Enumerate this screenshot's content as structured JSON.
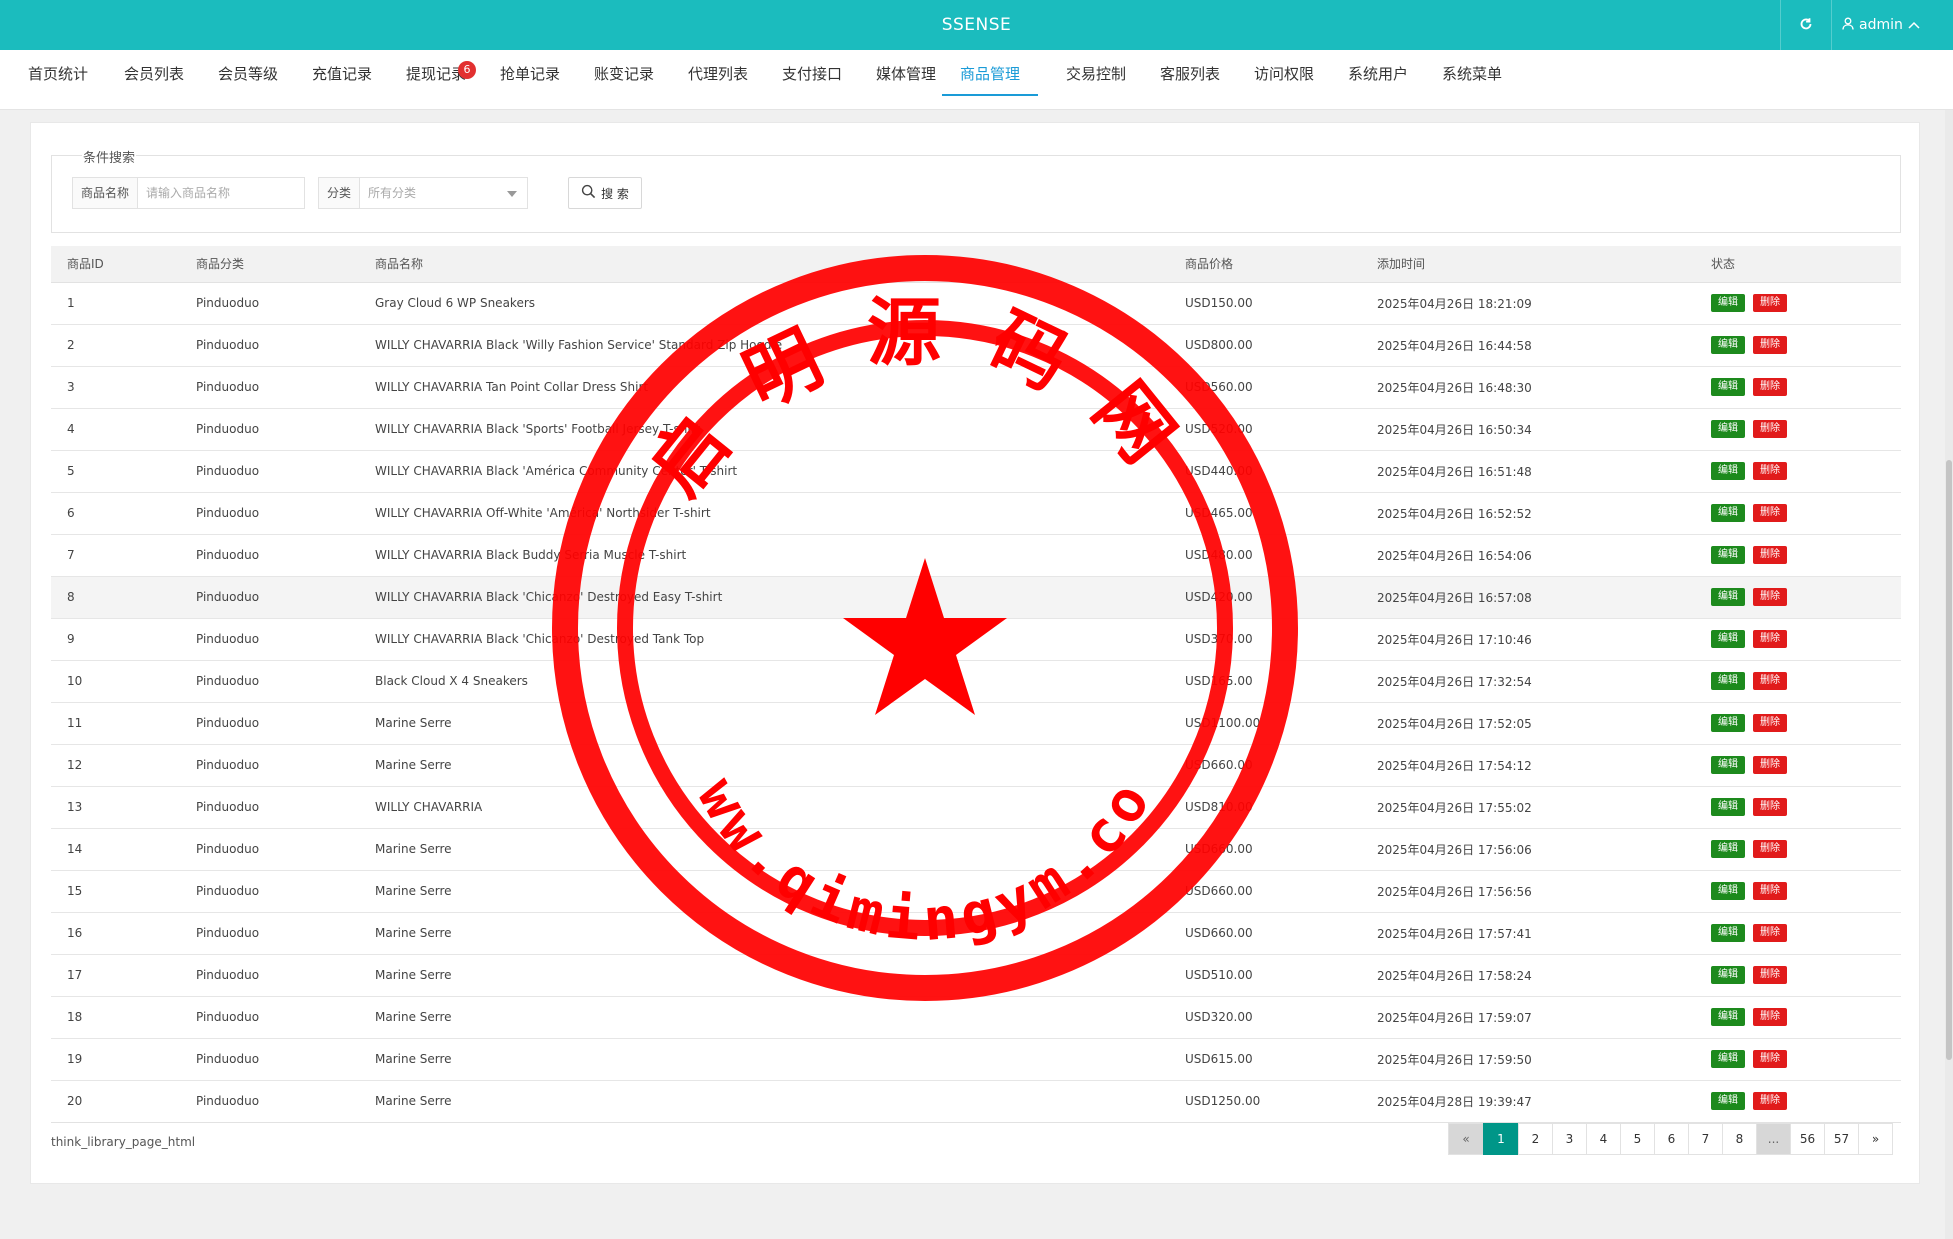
{
  "header": {
    "title": "SSENSE",
    "user": "admin"
  },
  "nav": {
    "items": [
      {
        "label": "首页统计"
      },
      {
        "label": "会员列表"
      },
      {
        "label": "会员等级"
      },
      {
        "label": "充值记录"
      },
      {
        "label": "提现记录",
        "badge": "6"
      },
      {
        "label": "抢单记录"
      },
      {
        "label": "账变记录"
      },
      {
        "label": "代理列表"
      },
      {
        "label": "支付接口"
      },
      {
        "label": "媒体管理"
      },
      {
        "label": "商品管理",
        "active": true
      },
      {
        "label": "交易控制"
      },
      {
        "label": "客服列表"
      },
      {
        "label": "访问权限"
      },
      {
        "label": "系统用户"
      },
      {
        "label": "系统菜单"
      }
    ]
  },
  "search": {
    "legend": "条件搜索",
    "name_label": "商品名称",
    "name_placeholder": "请输入商品名称",
    "category_label": "分类",
    "category_value": "所有分类",
    "button_label": "搜 索"
  },
  "table": {
    "columns": [
      "商品ID",
      "商品分类",
      "商品名称",
      "商品价格",
      "添加时间",
      "状态"
    ],
    "edit_label": "编辑",
    "delete_label": "删除",
    "rows": [
      {
        "id": "1",
        "category": "Pinduoduo",
        "name": "Gray Cloud 6 WP Sneakers",
        "price": "USD150.00",
        "time": "2025年04月26日 18:21:09"
      },
      {
        "id": "2",
        "category": "Pinduoduo",
        "name": "WILLY CHAVARRIA Black 'Willy Fashion Service' Standard Zip Hoodie",
        "price": "USD800.00",
        "time": "2025年04月26日 16:44:58"
      },
      {
        "id": "3",
        "category": "Pinduoduo",
        "name": "WILLY CHAVARRIA Tan Point Collar Dress Shirt",
        "price": "USD560.00",
        "time": "2025年04月26日 16:48:30"
      },
      {
        "id": "4",
        "category": "Pinduoduo",
        "name": "WILLY CHAVARRIA Black 'Sports' Football Jersey T-shirt",
        "price": "USD520.00",
        "time": "2025年04月26日 16:50:34"
      },
      {
        "id": "5",
        "category": "Pinduoduo",
        "name": "WILLY CHAVARRIA Black 'América Community Center' T-shirt",
        "price": "USD440.00",
        "time": "2025年04月26日 16:51:48"
      },
      {
        "id": "6",
        "category": "Pinduoduo",
        "name": "WILLY CHAVARRIA Off-White 'América' Northsider T-shirt",
        "price": "USD465.00",
        "time": "2025年04月26日 16:52:52"
      },
      {
        "id": "7",
        "category": "Pinduoduo",
        "name": "WILLY CHAVARRIA Black Buddy Serria Muscle T-shirt",
        "price": "USD480.00",
        "time": "2025年04月26日 16:54:06"
      },
      {
        "id": "8",
        "category": "Pinduoduo",
        "name": "WILLY CHAVARRIA Black 'Chicanzo' Destroyed Easy T-shirt",
        "price": "USD420.00",
        "time": "2025年04月26日 16:57:08"
      },
      {
        "id": "9",
        "category": "Pinduoduo",
        "name": "WILLY CHAVARRIA Black 'Chicanzo' Destroyed Tank Top",
        "price": "USD370.00",
        "time": "2025年04月26日 17:10:46"
      },
      {
        "id": "10",
        "category": "Pinduoduo",
        "name": "Black Cloud X 4 Sneakers",
        "price": "USD165.00",
        "time": "2025年04月26日 17:32:54"
      },
      {
        "id": "11",
        "category": "Pinduoduo",
        "name": "Marine Serre",
        "price": "USD1100.00",
        "time": "2025年04月26日 17:52:05"
      },
      {
        "id": "12",
        "category": "Pinduoduo",
        "name": "Marine Serre",
        "price": "USD660.00",
        "time": "2025年04月26日 17:54:12"
      },
      {
        "id": "13",
        "category": "Pinduoduo",
        "name": "WILLY CHAVARRIA",
        "price": "USD810.00",
        "time": "2025年04月26日 17:55:02"
      },
      {
        "id": "14",
        "category": "Pinduoduo",
        "name": "Marine Serre",
        "price": "USD660.00",
        "time": "2025年04月26日 17:56:06"
      },
      {
        "id": "15",
        "category": "Pinduoduo",
        "name": "Marine Serre",
        "price": "USD660.00",
        "time": "2025年04月26日 17:56:56"
      },
      {
        "id": "16",
        "category": "Pinduoduo",
        "name": "Marine Serre",
        "price": "USD660.00",
        "time": "2025年04月26日 17:57:41"
      },
      {
        "id": "17",
        "category": "Pinduoduo",
        "name": "Marine Serre",
        "price": "USD510.00",
        "time": "2025年04月26日 17:58:24"
      },
      {
        "id": "18",
        "category": "Pinduoduo",
        "name": "Marine Serre",
        "price": "USD320.00",
        "time": "2025年04月26日 17:59:07"
      },
      {
        "id": "19",
        "category": "Pinduoduo",
        "name": "Marine Serre",
        "price": "USD615.00",
        "time": "2025年04月26日 17:59:50"
      },
      {
        "id": "20",
        "category": "Pinduoduo",
        "name": "Marine Serre",
        "price": "USD1250.00",
        "time": "2025年04月28日 19:39:47"
      }
    ]
  },
  "footer": {
    "page_html": "think_library_page_html"
  },
  "pagination": {
    "prev": "«",
    "pages": [
      "1",
      "2",
      "3",
      "4",
      "5",
      "6",
      "7",
      "8"
    ],
    "ellipsis": "...",
    "last_pages": [
      "56",
      "57"
    ],
    "next": "»"
  },
  "watermark": {
    "top_text": "启明源码网",
    "bottom_text": "www.qimingym.com"
  },
  "colors": {
    "header": "#1bbcbe",
    "nav_active": "#1a9bd7",
    "edit": "#1d8a1d",
    "delete": "#e11b1b",
    "page_current": "#009688",
    "stamp": "#ff0000"
  }
}
